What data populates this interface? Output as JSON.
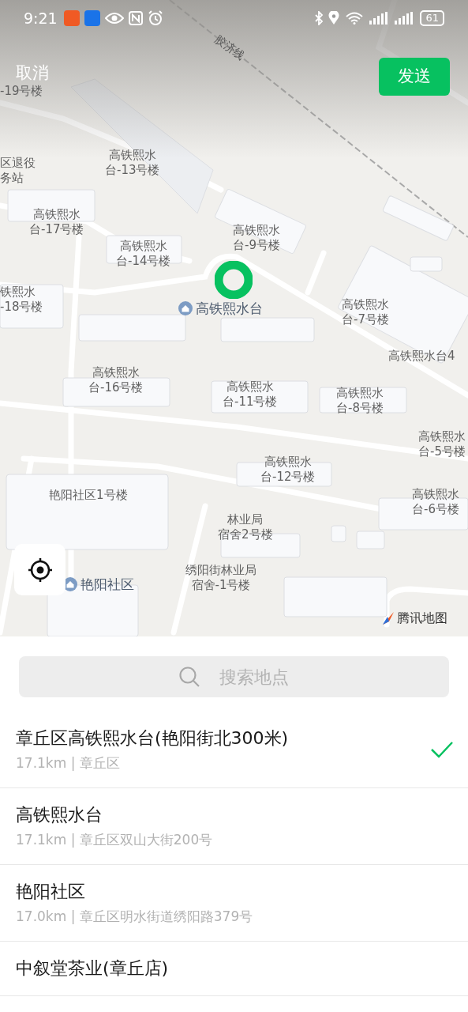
{
  "status_bar": {
    "time": "9:21",
    "battery": "61"
  },
  "top_bar": {
    "cancel": "取消",
    "send": "发送"
  },
  "map": {
    "railway_label": "胶济线",
    "labels": [
      {
        "kind": "building",
        "lines": [
          "-19号楼"
        ]
      },
      {
        "kind": "building",
        "lines": [
          "区退役",
          "务站"
        ]
      },
      {
        "kind": "building",
        "lines": [
          "高铁熙水",
          "台-13号楼"
        ]
      },
      {
        "kind": "building",
        "lines": [
          "高铁熙水",
          "台-17号楼"
        ]
      },
      {
        "kind": "building",
        "lines": [
          "高铁熙水",
          "台-9号楼"
        ]
      },
      {
        "kind": "building",
        "lines": [
          "高铁熙水",
          "台-14号楼"
        ]
      },
      {
        "kind": "building",
        "lines": [
          "铁熙水",
          "-18号楼"
        ]
      },
      {
        "kind": "poi",
        "lines": [
          "高铁熙水台"
        ]
      },
      {
        "kind": "building",
        "lines": [
          "高铁熙水",
          "台-7号楼"
        ]
      },
      {
        "kind": "building",
        "lines": [
          "高铁熙水台4"
        ]
      },
      {
        "kind": "building",
        "lines": [
          "高铁熙水",
          "台-16号楼"
        ]
      },
      {
        "kind": "building",
        "lines": [
          "高铁熙水",
          "台-11号楼"
        ]
      },
      {
        "kind": "building",
        "lines": [
          "高铁熙水",
          "台-8号楼"
        ]
      },
      {
        "kind": "building",
        "lines": [
          "高铁熙水",
          "台-5号楼"
        ]
      },
      {
        "kind": "building",
        "lines": [
          "高铁熙水",
          "台-12号楼"
        ]
      },
      {
        "kind": "building",
        "lines": [
          "艳阳社区1号楼"
        ]
      },
      {
        "kind": "building",
        "lines": [
          "高铁熙水",
          "台-6号楼"
        ]
      },
      {
        "kind": "building",
        "lines": [
          "林业局",
          "宿舍2号楼"
        ]
      },
      {
        "kind": "poi",
        "lines": [
          "艳阳社区"
        ]
      },
      {
        "kind": "building",
        "lines": [
          "绣阳街林业局",
          "宿舍-1号楼"
        ]
      }
    ],
    "attribution": "腾讯地图"
  },
  "search": {
    "placeholder": "搜索地点"
  },
  "results": [
    {
      "title": "章丘区高铁熙水台(艳阳街北300米)",
      "subtitle": "17.1km | 章丘区",
      "selected": true
    },
    {
      "title": "高铁熙水台",
      "subtitle": "17.1km | 章丘区双山大街200号",
      "selected": false
    },
    {
      "title": "艳阳社区",
      "subtitle": "17.0km | 章丘区明水街道绣阳路379号",
      "selected": false
    },
    {
      "title": "中叙堂茶业(章丘店)",
      "selected": false
    }
  ]
}
